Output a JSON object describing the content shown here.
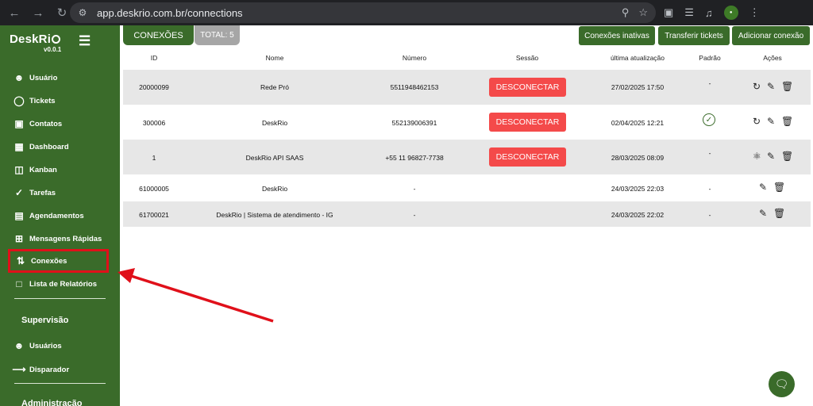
{
  "browser": {
    "url": "app.deskrio.com.br/connections",
    "icons": [
      "back-icon",
      "forward-icon",
      "reload-icon",
      "site-info-icon",
      "zoom-icon",
      "star-icon",
      "extension-icon",
      "translate-icon",
      "media-icon",
      "profile-avatar"
    ]
  },
  "sidebar": {
    "logo": "DeskRi",
    "version": "v0.0.1",
    "items": [
      {
        "label": "Usuário",
        "icon": "user-icon"
      },
      {
        "label": "Tickets",
        "icon": "chat-icon"
      },
      {
        "label": "Contatos",
        "icon": "contact-icon"
      },
      {
        "label": "Dashboard",
        "icon": "dashboard-icon"
      },
      {
        "label": "Kanban",
        "icon": "kanban-icon"
      },
      {
        "label": "Tarefas",
        "icon": "tasks-icon"
      },
      {
        "label": "Agendamentos",
        "icon": "calendar-icon"
      },
      {
        "label": "Mensagens Rápidas",
        "icon": "quick-message-icon"
      },
      {
        "label": "Conexões",
        "icon": "connections-icon"
      },
      {
        "label": "Lista de Relatórios",
        "icon": "reports-icon"
      }
    ],
    "supervision_title": "Supervisão",
    "supervision_items": [
      {
        "label": "Usuários",
        "icon": "users-icon"
      },
      {
        "label": "Disparador",
        "icon": "arrow-right-icon"
      }
    ],
    "admin_title": "Administração"
  },
  "header": {
    "title": "CONEXÕES",
    "total": "TOTAL: 5",
    "buttons": {
      "inactive": "Conexões inativas",
      "transfer": "Transferir tickets",
      "add": "Adicionar conexão"
    }
  },
  "table": {
    "columns": [
      "ID",
      "Nome",
      "Número",
      "Sessão",
      "última atualização",
      "Padrão",
      "Ações"
    ],
    "rows": [
      {
        "id": "20000099",
        "name": "Rede Pró",
        "number": "5511948462153",
        "session": "DESCONECTAR",
        "updated": "27/02/2025 17:50",
        "default": "-"
      },
      {
        "id": "300006",
        "name": "DeskRio",
        "number": "552139006391",
        "session": "DESCONECTAR",
        "updated": "02/04/2025 12:21",
        "default": "check"
      },
      {
        "id": "1",
        "name": "DeskRio API SAAS",
        "number": "+55 11 96827-7738",
        "session": "DESCONECTAR",
        "updated": "28/03/2025 08:09",
        "default": "-"
      },
      {
        "id": "61000005",
        "name": "DeskRio",
        "number": "-",
        "session": "",
        "updated": "24/03/2025 22:03",
        "default": "-"
      },
      {
        "id": "61700021",
        "name": "DeskRio | Sistema de atendimento - IG",
        "number": "-",
        "session": "",
        "updated": "24/03/2025 22:02",
        "default": "-"
      }
    ]
  },
  "colors": {
    "brand_green": "#3a6b2a",
    "disconnect_red": "#f44a4a",
    "highlight_red": "#e0101a",
    "row_shade": "#e7e7e7"
  }
}
